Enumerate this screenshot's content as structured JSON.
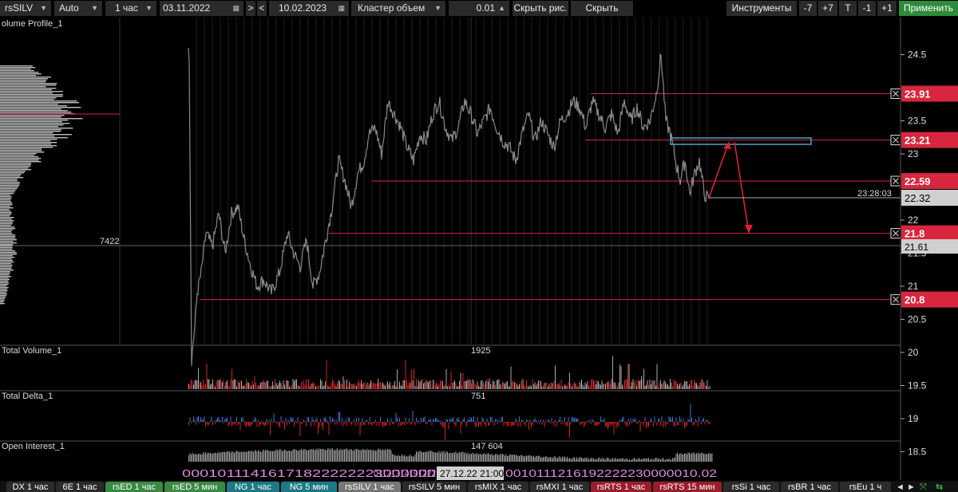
{
  "toolbar": {
    "symbol": "rsSILV",
    "scale": "Auto",
    "timeframe": "1 час",
    "date_from": "03.11.2022",
    "nav_next": ">",
    "nav_prev": "<",
    "date_to": "10.02.2023",
    "indicator": "Кластер объем",
    "step": "0.01",
    "hide_drawings": "Скрыть рис.",
    "hide_lines": "Скрыть линии",
    "tools": "Инструменты",
    "minus7": "-7",
    "plus7": "+7",
    "t": "T",
    "minus1": "-1",
    "plus1": "+1",
    "apply": "Применить"
  },
  "panels": {
    "volume_profile": "olume Profile_1",
    "profile_max": "7422",
    "total_volume": "Total Volume_1",
    "total_volume_val": "1925",
    "total_delta": "Total Delta_1",
    "total_delta_val": "751",
    "open_interest": "Open Interest_1",
    "open_interest_val": "147 604"
  },
  "price_axis": {
    "ticks": [
      "24.5",
      "23.5",
      "23",
      "22",
      "21.5",
      "21",
      "20.5",
      "20",
      "19.5",
      "19",
      "18.5"
    ],
    "levels": [
      {
        "price": "23.91",
        "color": "#d7263d"
      },
      {
        "price": "23.21",
        "color": "#d7263d"
      },
      {
        "price": "22.59",
        "color": "#d7263d"
      },
      {
        "price": "21.8",
        "color": "#d7263d"
      },
      {
        "price": "20.8",
        "color": "#d7263d"
      }
    ],
    "last_price": "22.32",
    "cursor_price": "21.61",
    "timer": "23:28:03"
  },
  "time_axis": {
    "labels_left": "00010111416171822222223000000",
    "labels_mid": "01121314191222",
    "cursor_label": "27.12.22 21:00",
    "labels_right": "0010111216192222230000010.02"
  },
  "tabs": [
    {
      "label": "DX 1 час",
      "style": "dark"
    },
    {
      "label": "6E 1 час",
      "style": "dark"
    },
    {
      "label": "rsED 1 час",
      "style": "green"
    },
    {
      "label": "rsED 5 мин",
      "style": "green"
    },
    {
      "label": "NG 1 час",
      "style": "teal"
    },
    {
      "label": "NG 5 мин",
      "style": "teal"
    },
    {
      "label": "rsSILV 1 час",
      "style": "grey"
    },
    {
      "label": "rsSILV 5 мин",
      "style": "dark"
    },
    {
      "label": "rsMIX 1 час",
      "style": "dark"
    },
    {
      "label": "rsMXI 1 час",
      "style": "dark"
    },
    {
      "label": "rsRTS 1 час",
      "style": "red"
    },
    {
      "label": "rsRTS 15 мин",
      "style": "red"
    },
    {
      "label": "rsSi 1 час",
      "style": "dark"
    },
    {
      "label": "rsBR 1 час",
      "style": "dark"
    },
    {
      "label": "rsEu 1 ч",
      "style": "dark"
    }
  ],
  "tab_nav": {
    "prev": "◄",
    "next": "►",
    "icon": "⤧"
  }
}
